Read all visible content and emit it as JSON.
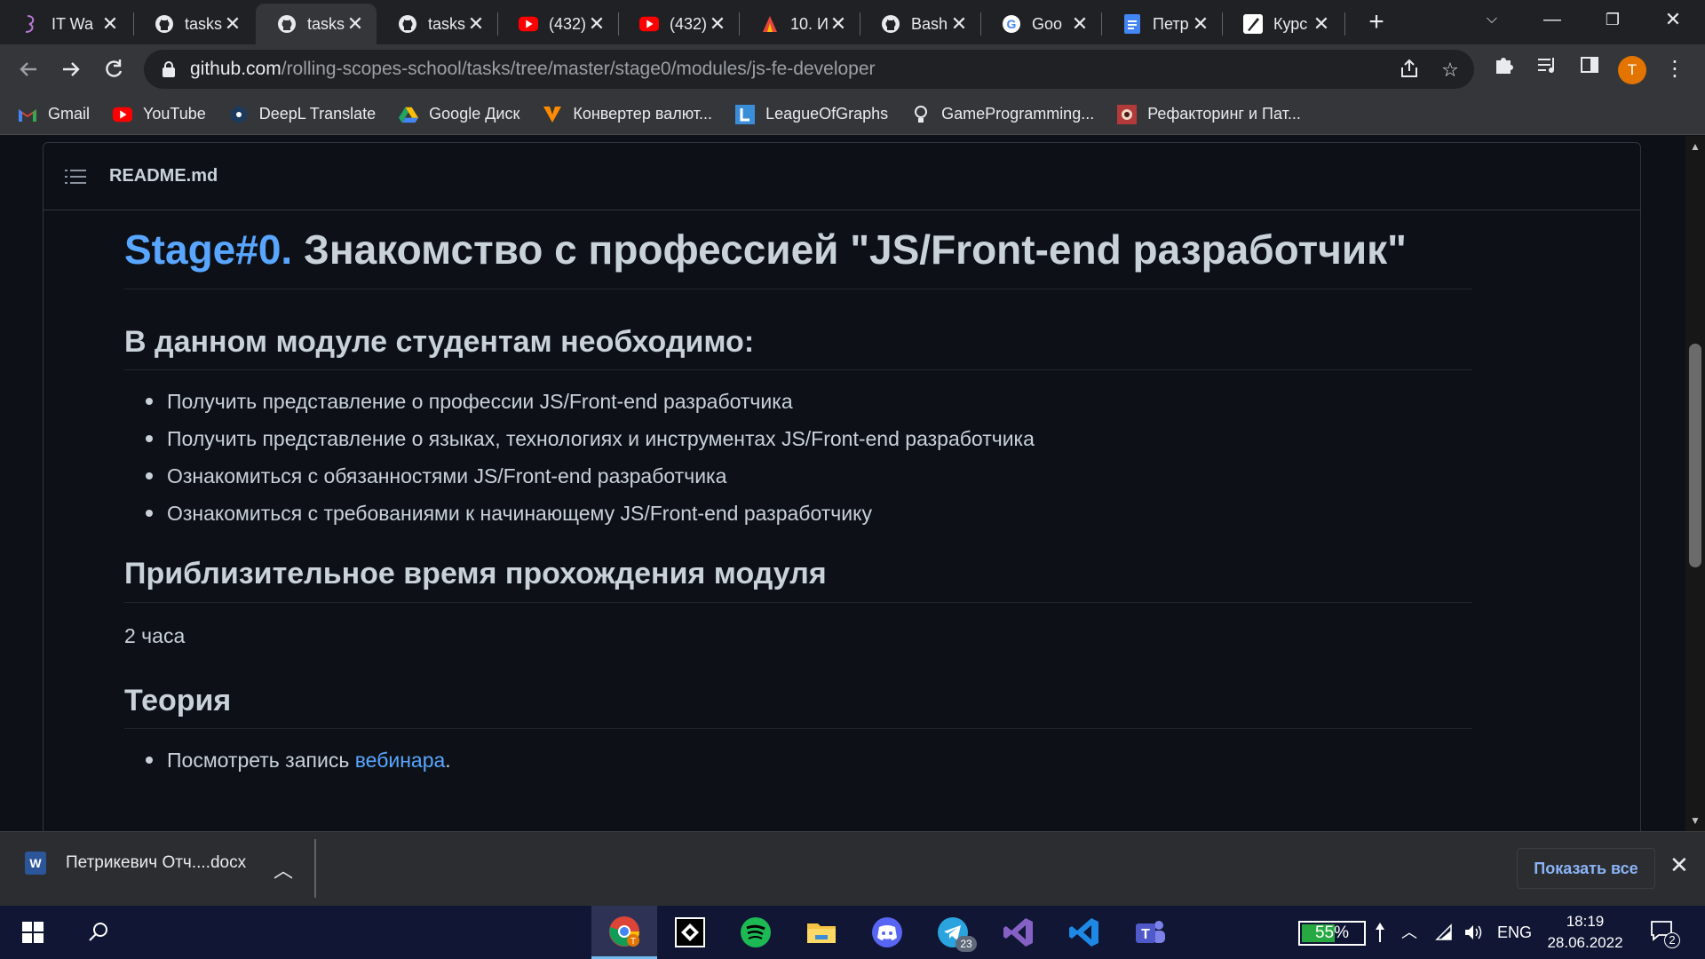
{
  "tabs": [
    {
      "title": "IT Wa",
      "icon": "rs-school-icon",
      "active": false
    },
    {
      "title": "tasks",
      "icon": "github-icon",
      "active": false
    },
    {
      "title": "tasks",
      "icon": "github-icon",
      "active": true
    },
    {
      "title": "tasks",
      "icon": "github-icon",
      "active": false
    },
    {
      "title": "(432)",
      "icon": "youtube-icon",
      "active": false
    },
    {
      "title": "(432)",
      "icon": "youtube-icon",
      "active": false
    },
    {
      "title": "10. И",
      "icon": "html-academy-icon",
      "active": false
    },
    {
      "title": "Bash",
      "icon": "github-icon",
      "active": false
    },
    {
      "title": "Goo",
      "icon": "google-icon",
      "active": false
    },
    {
      "title": "Петр",
      "icon": "google-docs-icon",
      "active": false
    },
    {
      "title": "Курс",
      "icon": "quill-icon",
      "active": false
    }
  ],
  "address": {
    "host": "github.com",
    "path": "/rolling-scopes-school/tasks/tree/master/stage0/modules/js-fe-developer"
  },
  "profile_initial": "T",
  "bookmarks": [
    {
      "label": "Gmail",
      "icon": "gmail-icon",
      "color": "#ea4335",
      "glyph": "M"
    },
    {
      "label": "YouTube",
      "icon": "youtube-icon",
      "color": "#ff0000",
      "glyph": "▶"
    },
    {
      "label": "DeepL Translate",
      "icon": "deepl-icon",
      "color": "#0f2b46",
      "glyph": "⬢"
    },
    {
      "label": "Google Диск",
      "icon": "google-drive-icon",
      "color": "#1fa463",
      "glyph": "▲"
    },
    {
      "label": "Конвертер валют...",
      "icon": "currency-converter-icon",
      "color": "#ff8a00",
      "glyph": "V"
    },
    {
      "label": "LeagueOfGraphs",
      "icon": "leagueofgraphs-icon",
      "color": "#3a8ed8",
      "glyph": "L"
    },
    {
      "label": "GameProgramming...",
      "icon": "lightbulb-icon",
      "color": "#e8eaed",
      "glyph": "💡"
    },
    {
      "label": "Рефакторинг и Пат...",
      "icon": "refactoring-guru-icon",
      "color": "#b33a3a",
      "glyph": "▣"
    }
  ],
  "readme": {
    "filename": "README.md",
    "title_link": "Stage#0.",
    "title_rest": " Знакомство с профессией \"JS/Front-end разработчик\"",
    "section1_heading": "В данном модуле студентам необходимо:",
    "section1_items": [
      "Получить представление о профессии JS/Front-end разработчика",
      "Получить представление о языках, технологиях и инструментах JS/Front-end разработчика",
      "Ознакомиться с обязанностями JS/Front-end разработчика",
      "Ознакомиться с требованиями к начинающему JS/Front-end разработчику"
    ],
    "section2_heading": "Приблизительное время прохождения модуля",
    "section2_text": "2 часа",
    "section3_heading": "Теория",
    "section3_item_prefix": "Посмотреть запись ",
    "section3_item_link": "вебинара",
    "section3_item_suffix": "."
  },
  "download": {
    "filename": "Петрикевич Отч....docx",
    "show_all": "Показать все"
  },
  "taskbar": {
    "apps": [
      {
        "name": "chrome-icon",
        "color": "#db4437",
        "glyph": "◉",
        "active": true
      },
      {
        "name": "jetbrains-toolbox-icon",
        "color": "#000000",
        "glyph": "◆",
        "active": false
      },
      {
        "name": "spotify-icon",
        "color": "#1db954",
        "glyph": "≋",
        "active": false
      },
      {
        "name": "file-explorer-icon",
        "color": "#f6c343",
        "glyph": "▭",
        "active": false
      },
      {
        "name": "discord-icon",
        "color": "#5865f2",
        "glyph": "◕",
        "active": false
      },
      {
        "name": "telegram-icon",
        "color": "#2aa3df",
        "glyph": "➤",
        "active": false
      },
      {
        "name": "visual-studio-icon",
        "color": "#8661c5",
        "glyph": "∞",
        "active": false
      },
      {
        "name": "vscode-icon",
        "color": "#1e88e5",
        "glyph": "❮❯",
        "active": false
      },
      {
        "name": "teams-icon",
        "color": "#5059c9",
        "glyph": "T",
        "active": false
      }
    ],
    "telegram_badge": "23",
    "battery_percent": "55%",
    "battery_level": 0.55,
    "language": "ENG",
    "time": "18:19",
    "date": "28.06.2022",
    "notifications": "2"
  }
}
